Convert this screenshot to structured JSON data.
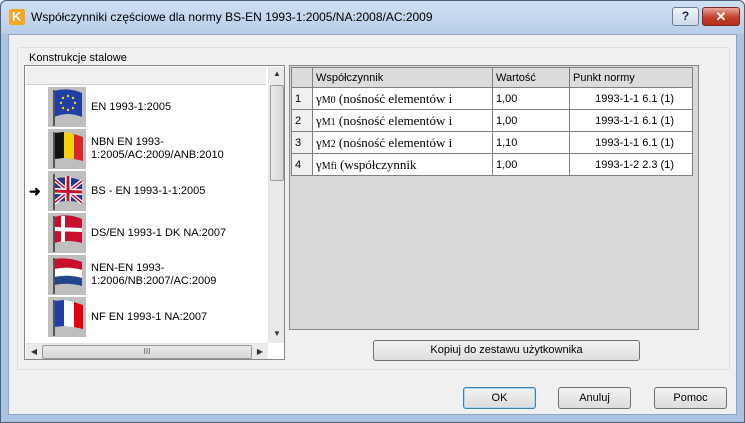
{
  "window": {
    "title": "Współczynniki częściowe dla normy BS-EN 1993-1:2005/NA:2008/AC:2009",
    "help_label": "?",
    "close_label": "✕"
  },
  "group": {
    "label": "Konstrukcje stalowe"
  },
  "norms_list": {
    "selected_index": 2,
    "items": [
      {
        "label": "EN 1993-1:2005",
        "flag": "eu-flag-icon"
      },
      {
        "label": "NBN EN 1993-1:2005/AC:2009/ANB:2010",
        "flag": "belgium-flag-icon"
      },
      {
        "label": "BS - EN 1993-1-1:2005",
        "flag": "uk-flag-icon"
      },
      {
        "label": "DS/EN 1993-1 DK NA:2007",
        "flag": "denmark-flag-icon"
      },
      {
        "label": "NEN-EN 1993-1:2006/NB:2007/AC:2009",
        "flag": "netherlands-flag-icon"
      },
      {
        "label": "NF EN 1993-1 NA:2007",
        "flag": "france-flag-icon"
      }
    ],
    "selected_marker": "➜"
  },
  "grid": {
    "headers": [
      "",
      "Współczynnik",
      "Wartość",
      "Punkt normy"
    ],
    "rows": [
      {
        "num": "1",
        "symbol": "γ",
        "sub": "M0",
        "desc": " (nośność elementów i",
        "value": "1,00",
        "ref": "1993-1-1  6.1 (1)"
      },
      {
        "num": "2",
        "symbol": "γ",
        "sub": "M1",
        "desc": " (nośność elementów i",
        "value": "1,00",
        "ref": "1993-1-1  6.1 (1)"
      },
      {
        "num": "3",
        "symbol": "γ",
        "sub": "M2",
        "desc": " (nośność elementów i",
        "value": "1,10",
        "ref": "1993-1-1  6.1 (1)"
      },
      {
        "num": "4",
        "symbol": "γ",
        "sub": "Mfi",
        "desc": " (współczynnik",
        "value": "1,00",
        "ref": "1993-1-2  2.3 (1)"
      }
    ]
  },
  "buttons": {
    "copy": "Kopiuj do zestawu użytkownika",
    "ok": "OK",
    "cancel": "Anuluj",
    "help": "Pomoc"
  }
}
